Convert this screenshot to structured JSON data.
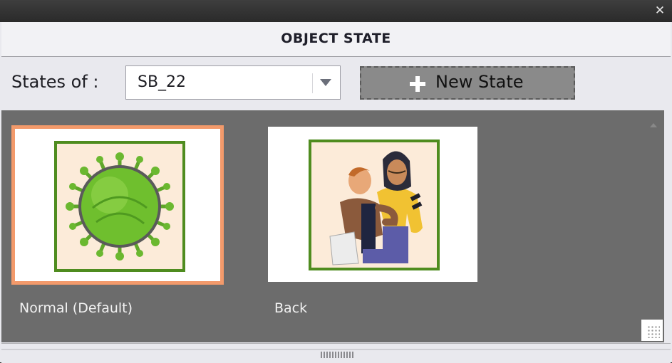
{
  "window": {
    "close_icon": "close-icon"
  },
  "header": {
    "title": "OBJECT STATE"
  },
  "toolbar": {
    "states_label": "States of :",
    "select_value": "SB_22",
    "new_state_label": "New State"
  },
  "states": [
    {
      "label": "Normal (Default)",
      "image": "virus-illustration",
      "selected": true
    },
    {
      "label": "Back",
      "image": "two-friends-illustration",
      "selected": false
    }
  ],
  "colors": {
    "selection_border": "#f39a6b",
    "frame_border": "#4f8c1f",
    "content_bg": "#6c6c6c"
  }
}
